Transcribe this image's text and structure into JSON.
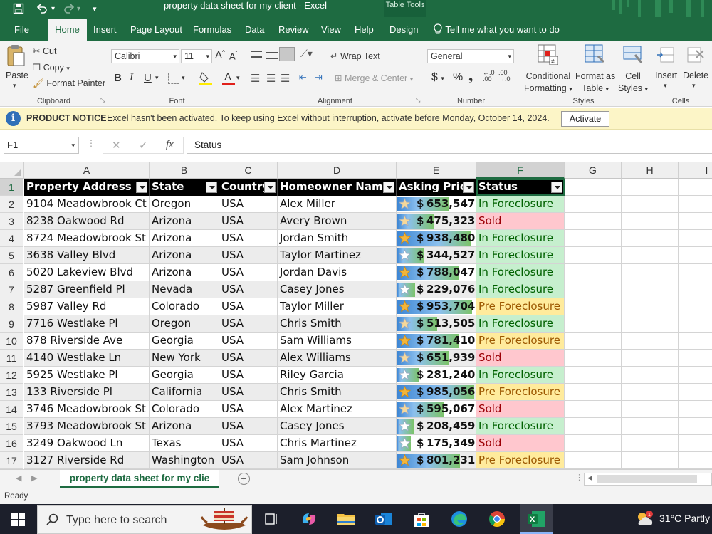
{
  "app": {
    "window_title": "property data sheet for my client  -  Excel",
    "contextual_tab": "Table Tools"
  },
  "tabs": [
    "File",
    "Home",
    "Insert",
    "Page Layout",
    "Formulas",
    "Data",
    "Review",
    "View",
    "Help",
    "Design"
  ],
  "active_tab": "Home",
  "tell_me": "Tell me what you want to do",
  "ribbon": {
    "clipboard": {
      "paste": "Paste",
      "cut": "Cut",
      "copy": "Copy",
      "format_painter": "Format Painter",
      "label": "Clipboard"
    },
    "font": {
      "name": "Calibri",
      "size": "11",
      "label": "Font"
    },
    "alignment": {
      "wrap": "Wrap Text",
      "merge": "Merge & Center",
      "label": "Alignment"
    },
    "number": {
      "format": "General",
      "label": "Number"
    },
    "styles": {
      "conditional": "Conditional",
      "conditional2": "Formatting",
      "format_as": "Format as",
      "format_as2": "Table",
      "cell": "Cell",
      "cell2": "Styles",
      "label": "Styles"
    },
    "cells": {
      "insert": "Insert",
      "delete": "Delete",
      "label": "Cells"
    }
  },
  "notice": {
    "heading": "PRODUCT NOTICE",
    "message": "Excel hasn't been activated. To keep using Excel without interruption, activate before Monday, October 14, 2024.",
    "button": "Activate"
  },
  "formula_bar": {
    "name_box": "F1",
    "fx": "fx",
    "content": "Status"
  },
  "columns": [
    "A",
    "B",
    "C",
    "D",
    "E",
    "F",
    "G",
    "H",
    "I"
  ],
  "table": {
    "headers": [
      "Property Address",
      "State",
      "Country",
      "Homeowner Name",
      "Asking Price",
      "Status"
    ],
    "rows": [
      [
        "9104 Meadowbrook Ct",
        "Oregon",
        "USA",
        "Alex Miller",
        "653,547",
        "In Foreclosure"
      ],
      [
        "8238 Oakwood Rd",
        "Arizona",
        "USA",
        "Avery Brown",
        "475,323",
        "Sold"
      ],
      [
        "8724 Meadowbrook St",
        "Arizona",
        "USA",
        "Jordan Smith",
        "938,480",
        "In Foreclosure"
      ],
      [
        "3638 Valley Blvd",
        "Arizona",
        "USA",
        "Taylor Martinez",
        "344,527",
        "In Foreclosure"
      ],
      [
        "5020 Lakeview Blvd",
        "Arizona",
        "USA",
        "Jordan Davis",
        "788,047",
        "In Foreclosure"
      ],
      [
        "5287 Greenfield Pl",
        "Nevada",
        "USA",
        "Casey Jones",
        "229,076",
        "In Foreclosure"
      ],
      [
        "5987 Valley Rd",
        "Colorado",
        "USA",
        "Taylor Miller",
        "953,704",
        "Pre Foreclosure"
      ],
      [
        "7716 Westlake Pl",
        "Oregon",
        "USA",
        "Chris Smith",
        "513,505",
        "In Foreclosure"
      ],
      [
        "878 Riverside Ave",
        "Georgia",
        "USA",
        "Sam Williams",
        "781,410",
        "Pre Foreclosure"
      ],
      [
        "4140 Westlake Ln",
        "New York",
        "USA",
        "Alex Williams",
        "651,939",
        "Sold"
      ],
      [
        "5925 Westlake Pl",
        "Georgia",
        "USA",
        "Riley Garcia",
        "281,240",
        "In Foreclosure"
      ],
      [
        "133 Riverside Pl",
        "California",
        "USA",
        "Chris Smith",
        "985,056",
        "Pre Foreclosure"
      ],
      [
        "3746 Meadowbrook St",
        "Colorado",
        "USA",
        "Alex Martinez",
        "595,067",
        "Sold"
      ],
      [
        "3793 Meadowbrook St",
        "Arizona",
        "USA",
        "Casey Jones",
        "208,459",
        "In Foreclosure"
      ],
      [
        "3249 Oakwood Ln",
        "Texas",
        "USA",
        "Chris Martinez",
        "175,349",
        "Sold"
      ],
      [
        "3127 Riverside Rd",
        "Washington",
        "USA",
        "Sam Johnson",
        "801,231",
        "Pre Foreclosure"
      ]
    ],
    "price_max": 1000000,
    "currency": "$"
  },
  "status_colors": {
    "In Foreclosure": {
      "bg": "#c6efce",
      "fg": "#006100"
    },
    "Sold": {
      "bg": "#ffc7ce",
      "fg": "#9c0006"
    },
    "Pre Foreclosure": {
      "bg": "#ffeb9c",
      "fg": "#9c5700"
    }
  },
  "sheet_tab": "property data sheet for my clie",
  "status_bar": "Ready",
  "taskbar": {
    "search_placeholder": "Type here to search",
    "weather": "31°C  Partly"
  }
}
